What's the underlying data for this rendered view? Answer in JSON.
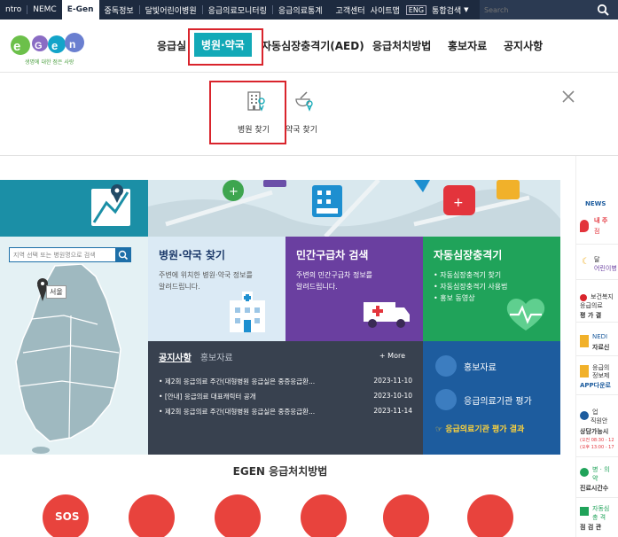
{
  "topbar": {
    "links": [
      "ntro",
      "NEMC",
      "E-Gen",
      "중독정보",
      "달빛어린이병원",
      "응급의료모니터링",
      "응급의료통계"
    ],
    "right_links": [
      "고객센터",
      "사이트맵"
    ],
    "eng": "ENG",
    "search_scope": "통합검색",
    "search_placeholder": "Search"
  },
  "header": {
    "logo_text": "e-Gen",
    "logo_tagline": "생명에 대한 점은 사랑",
    "nav": [
      "응급실",
      "병원·약국",
      "자동심장충격기(AED)",
      "응급처치방법",
      "홍보자료",
      "공지사항"
    ]
  },
  "dropdown": {
    "items": [
      "병원 찾기",
      "약국 찾기"
    ]
  },
  "map": {
    "search_placeholder": "지역 선택 또는 병원명으로 검색",
    "city_label": "서울"
  },
  "tiles": [
    {
      "title": "병원·약국 찾기",
      "desc1": "주변에 위치한 병원·약국 정보를",
      "desc2": "알려드립니다."
    },
    {
      "title": "민간구급차 검색",
      "desc1": "주변의 민간구급차 정보를",
      "desc2": "알려드립니다."
    },
    {
      "title": "자동심장충격기",
      "bullets": [
        "자동심장충격기 찾기",
        "자동심장충격기 사용법",
        "홍보 동영상"
      ]
    }
  ],
  "notice": {
    "tab_active": "공지사항",
    "tab_other": "홍보자료",
    "more": "+ More",
    "rows": [
      {
        "title": "제2회 응급의료 주간(대형병원 응급실은 중증응급환...",
        "date": "2023-11-10"
      },
      {
        "title": "[안내] 응급의료 대표캐릭터 공개",
        "date": "2023-10-10"
      },
      {
        "title": "제2회 응급의료 주간(대형병원 응급실은 중증응급환...",
        "date": "2023-11-14"
      }
    ]
  },
  "blue_panel": {
    "item1": "홍보자료",
    "item2": "응급의료기관 평가",
    "item3": "☞ 응급의료기관 평가 결과"
  },
  "first_aid": {
    "title": "EGEN 응급처치방법",
    "sos": "SOS"
  },
  "right_sidebar": {
    "b0": "NEWS",
    "b1a": "내 주",
    "b1b": "점",
    "b2a": "달",
    "b2b": "어린이병",
    "b3a": "보건복지",
    "b3b": "응급의료",
    "b3c": "평 가 결",
    "b4a": "NEDI",
    "b4b": "자료신",
    "b5a": "응급의",
    "b5b": "정보제",
    "b5c": "APP다운로",
    "b6a": "업",
    "b6b": "직원안",
    "b6c": "상담가능시",
    "b6d": "(오전 08:30 - 12",
    "b6e": "(오후 13:00 - 17",
    "b7a": "병 · 의",
    "b7b": "약",
    "b7c": "진료시간수",
    "b8a": "자동심",
    "b8b": "충 격",
    "b8c": "점 검 관"
  },
  "colors": {
    "topbar": "#1d2a3f",
    "accent": "#12a9b7",
    "highlight": "#d9242c",
    "tile_blue": "#dbeaf5",
    "tile_purple": "#6a3fa0",
    "tile_green": "#20a35a",
    "notice_bg": "#38414f",
    "blue_panel": "#1d5c9e"
  }
}
